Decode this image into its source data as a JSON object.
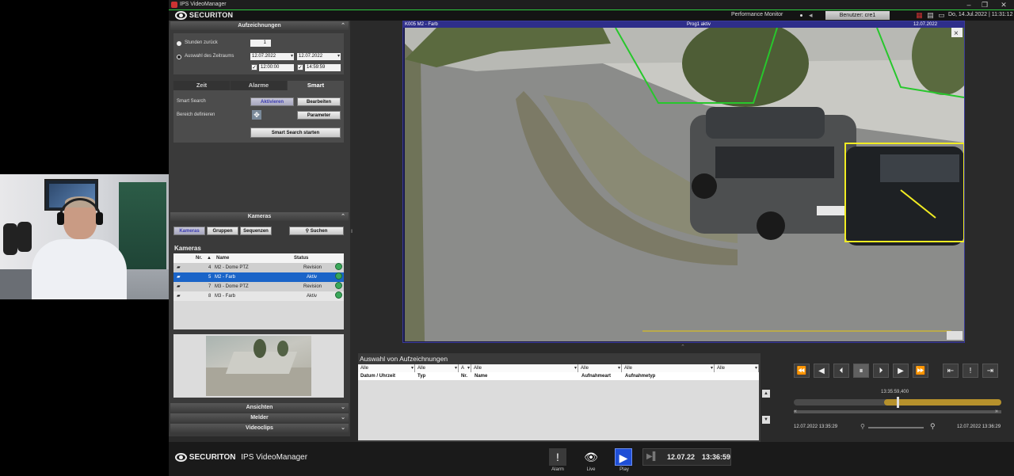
{
  "window": {
    "title": "IPS VideoManager",
    "buttons": [
      "–",
      "❐",
      "✕"
    ]
  },
  "topbar": {
    "brand": "SECURITON",
    "performance_monitor": "Performance Monitor",
    "user_button": "Benutzer: cre1",
    "datetime": "Do, 14.Jul.2022 | 11:31:12"
  },
  "recordings": {
    "title": "Aufzeichnungen",
    "stunden_label": "Stunden zurück",
    "stunden_value": "1",
    "range_label": "Auswahl des Zeitraums",
    "date_from": "12.07.2022",
    "date_to": "12.07.2022",
    "time_from": "12:00:00",
    "time_to": "14:59:59",
    "tabs": [
      "Zeit",
      "Alarme",
      "Smart"
    ],
    "active_tab": "Smart",
    "smart_search_label": "Smart Search",
    "activate_button": "Aktivieren",
    "edit_button": "Bearbeiten",
    "define_area_label": "Bereich definieren",
    "parameter_button": "Parameter",
    "start_button": "Smart Search starten"
  },
  "cameras": {
    "section_title": "Kameras",
    "tabs": [
      "Kameras",
      "Gruppen",
      "Sequenzen"
    ],
    "search_button": "Suchen",
    "list_title": "Kameras",
    "columns": [
      "Nr.",
      "Name",
      "Status"
    ],
    "rows": [
      {
        "nr": "4",
        "name": "M2 - Dome PTZ",
        "status": "Revision"
      },
      {
        "nr": "5",
        "name": "M2 - Farb",
        "status": "Aktiv"
      },
      {
        "nr": "7",
        "name": "M3 - Dome PTZ",
        "status": "Revision"
      },
      {
        "nr": "8",
        "name": "M3 - Farb",
        "status": "Aktiv"
      }
    ],
    "selected_index": 1
  },
  "lower_sections": [
    "Ansichten",
    "Melder",
    "Videoclips"
  ],
  "video": {
    "camera_label": "K005 M2 - Farb",
    "center_label": "Prog1 aktiv",
    "timestamp": "12.07.2022 13:35:59,400"
  },
  "recording_selection": {
    "title": "Auswahl von Aufzeichnungen",
    "filters": [
      "Alle",
      "Alle",
      "A",
      "Alle",
      "Alle",
      "Alle",
      "Alle"
    ],
    "columns": [
      "Datum / Uhrzeit",
      "Typ",
      "Nr.",
      "Name",
      "Aufnahmeart",
      "Aufnahmetyp"
    ]
  },
  "playback": {
    "current_time": "13:35:59,400",
    "start_label": "12.07.2022 13:35:29",
    "end_label": "12.07.2022 13:36:29",
    "progress_fraction": 0.5
  },
  "bottombar": {
    "brand": "SECURITON",
    "product": "IPS VideoManager",
    "alarm_label": "Alarm",
    "live_label": "Live",
    "play_label": "Play",
    "date_display": "12.07.22",
    "time_display": "13:36:59"
  }
}
